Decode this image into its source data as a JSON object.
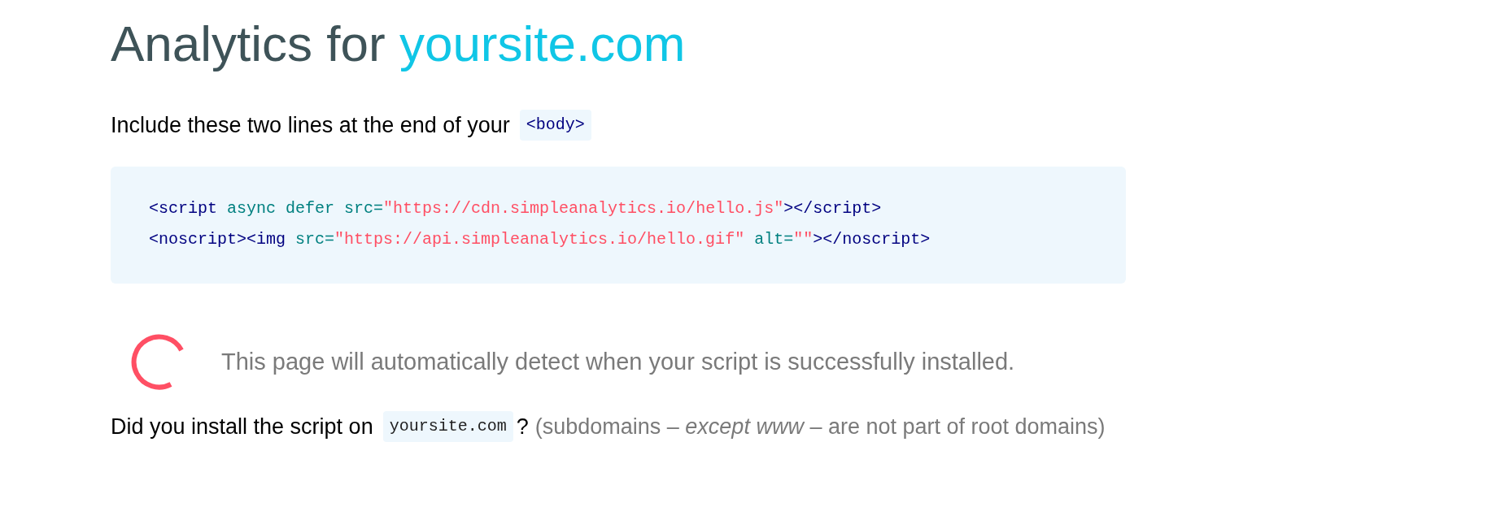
{
  "title": {
    "prefix": "Analytics for",
    "domain": "yoursite.com"
  },
  "instruction": {
    "text": "Include these two lines at the end of your",
    "code": "<body>"
  },
  "code_block": {
    "lines": [
      [
        {
          "kind": "tag",
          "text": "<script"
        },
        {
          "kind": "attr",
          "text": " async defer src="
        },
        {
          "kind": "string",
          "text": "\"https://cdn.simpleanalytics.io/hello.js\""
        },
        {
          "kind": "tag",
          "text": "></script>"
        }
      ],
      [
        {
          "kind": "tag",
          "text": "<noscript><img"
        },
        {
          "kind": "attr",
          "text": " src="
        },
        {
          "kind": "string",
          "text": "\"https://api.simpleanalytics.io/hello.gif\""
        },
        {
          "kind": "attr",
          "text": " alt="
        },
        {
          "kind": "string",
          "text": "\"\""
        },
        {
          "kind": "tag",
          "text": "></noscript>"
        }
      ]
    ]
  },
  "status": {
    "text": "This page will automatically detect when your script is successfully installed."
  },
  "question": {
    "text": "Did you install the script on",
    "domain": "yoursite.com",
    "mark": "?",
    "note": "(subdomains – *except www* – are not part of root domains)"
  }
}
